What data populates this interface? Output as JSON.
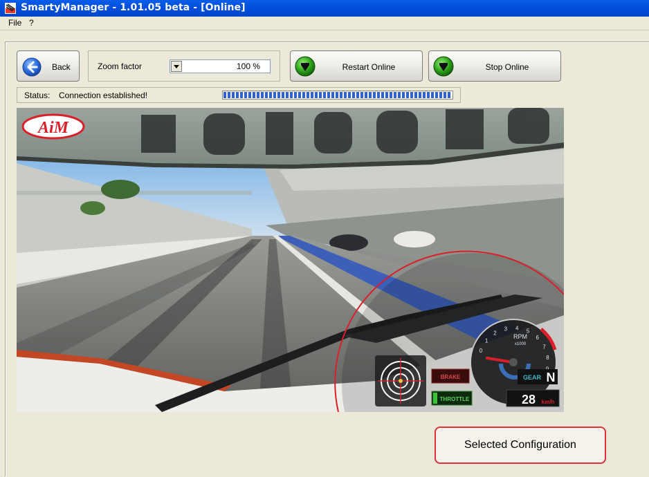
{
  "window": {
    "title": "SmartyManager - 1.01.05 beta - [Online]"
  },
  "menu": {
    "items": [
      "File",
      "?"
    ]
  },
  "toolbar": {
    "back_label": "Back",
    "zoom_label": "Zoom factor",
    "zoom_value": "100 %",
    "restart_label": "Restart Online",
    "stop_label": "Stop Online"
  },
  "status": {
    "label": "Status:",
    "text": "Connection established!",
    "progress": 1.0
  },
  "video": {
    "logo": "AiM",
    "overlay": {
      "rpm_label": "RPM",
      "rpm_unit": "x1000",
      "rpm_ticks": [
        "0",
        "1",
        "2",
        "3",
        "4",
        "5",
        "6",
        "7",
        "8",
        "9",
        "10"
      ],
      "gear_label": "GEAR",
      "gear_value": "N",
      "speed_value": "28",
      "speed_unit": "km/h",
      "brake_label": "BRAKE",
      "throttle_label": "THROTTLE"
    }
  },
  "annotation": {
    "text": "Selected Configuration"
  },
  "colors": {
    "titlebar": "#0050e0",
    "progress": "#2f62d8",
    "annotation_border": "#e0303a",
    "overlay_red": "#d9202a"
  }
}
